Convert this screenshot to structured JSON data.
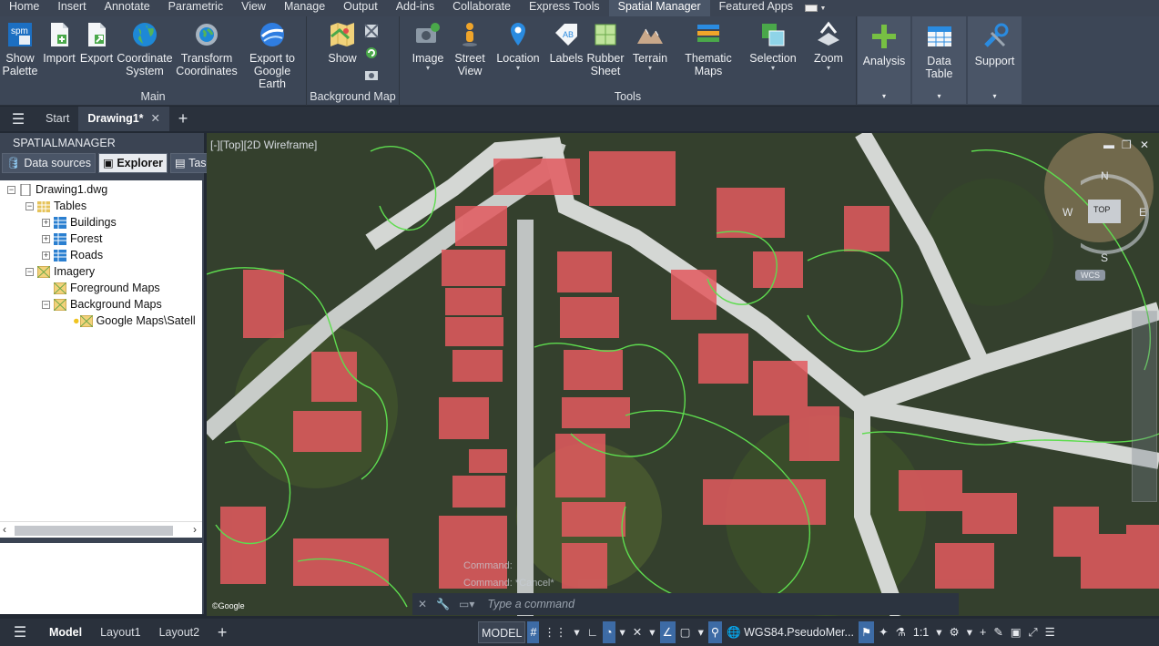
{
  "ribbon_tabs": [
    "Home",
    "Insert",
    "Annotate",
    "Parametric",
    "View",
    "Manage",
    "Output",
    "Add-ins",
    "Collaborate",
    "Express Tools",
    "Spatial Manager",
    "Featured Apps"
  ],
  "ribbon": {
    "main": {
      "title": "Main",
      "buttons": [
        {
          "label1": "Show",
          "label2": "Palette",
          "icon": "spm-palette-icon"
        },
        {
          "label1": "Import",
          "label2": "",
          "icon": "import-icon"
        },
        {
          "label1": "Export",
          "label2": "",
          "icon": "export-icon"
        },
        {
          "label1": "Coordinate",
          "label2": "System",
          "icon": "globe-icon"
        },
        {
          "label1": "Transform",
          "label2": "Coordinates",
          "icon": "transform-globe-icon"
        },
        {
          "label1": "Export to",
          "label2": "Google Earth",
          "icon": "google-earth-icon"
        }
      ]
    },
    "background_map": {
      "title": "Background Map",
      "show_label": "Show"
    },
    "tools": {
      "title": "Tools",
      "buttons": [
        {
          "label1": "Image",
          "label2": "",
          "icon": "image-icon"
        },
        {
          "label1": "Street",
          "label2": "View",
          "icon": "street-view-icon"
        },
        {
          "label1": "Location",
          "label2": "",
          "icon": "location-pin-icon"
        },
        {
          "label1": "Labels",
          "label2": "",
          "icon": "labels-icon"
        },
        {
          "label1": "Rubber",
          "label2": "Sheet",
          "icon": "rubber-sheet-icon"
        },
        {
          "label1": "Terrain",
          "label2": "",
          "icon": "terrain-icon"
        },
        {
          "label1": "Thematic",
          "label2": "Maps",
          "icon": "thematic-maps-icon"
        },
        {
          "label1": "Selection",
          "label2": "",
          "icon": "selection-icon"
        },
        {
          "label1": "Zoom",
          "label2": "",
          "icon": "zoom-icon"
        }
      ]
    },
    "extra": [
      {
        "label": "Analysis",
        "icon": "analysis-icon"
      },
      {
        "label": "Data Table",
        "icon": "data-table-icon"
      },
      {
        "label": "Support",
        "icon": "support-icon"
      }
    ]
  },
  "doc_tabs": {
    "start": "Start",
    "active": "Drawing1*",
    "close": "✕",
    "add": "+"
  },
  "palette": {
    "title": "SPATIALMANAGER",
    "tabs": [
      "Data sources",
      "Explorer",
      "Tasks"
    ],
    "tree": [
      {
        "label": "Drawing1.dwg"
      },
      {
        "label": "Tables"
      },
      {
        "label": "Buildings"
      },
      {
        "label": "Forest"
      },
      {
        "label": "Roads"
      },
      {
        "label": "Imagery"
      },
      {
        "label": "Foreground Maps"
      },
      {
        "label": "Background Maps"
      },
      {
        "label": "Google Maps\\Satell"
      }
    ]
  },
  "viewport": {
    "label": "[-][Top][2D Wireframe]",
    "compass": {
      "n": "N",
      "s": "S",
      "e": "E",
      "w": "W",
      "top": "TOP",
      "wcs": "WCS"
    },
    "command_placeholder": "Type a command",
    "command_history": [
      "Command:",
      "Command: *Cancel*"
    ],
    "google_text": "©Google"
  },
  "status": {
    "layout_tabs": [
      "Model",
      "Layout1",
      "Layout2"
    ],
    "model": "MODEL",
    "crs": "WGS84.PseudoMer...",
    "scale": "1:1"
  }
}
